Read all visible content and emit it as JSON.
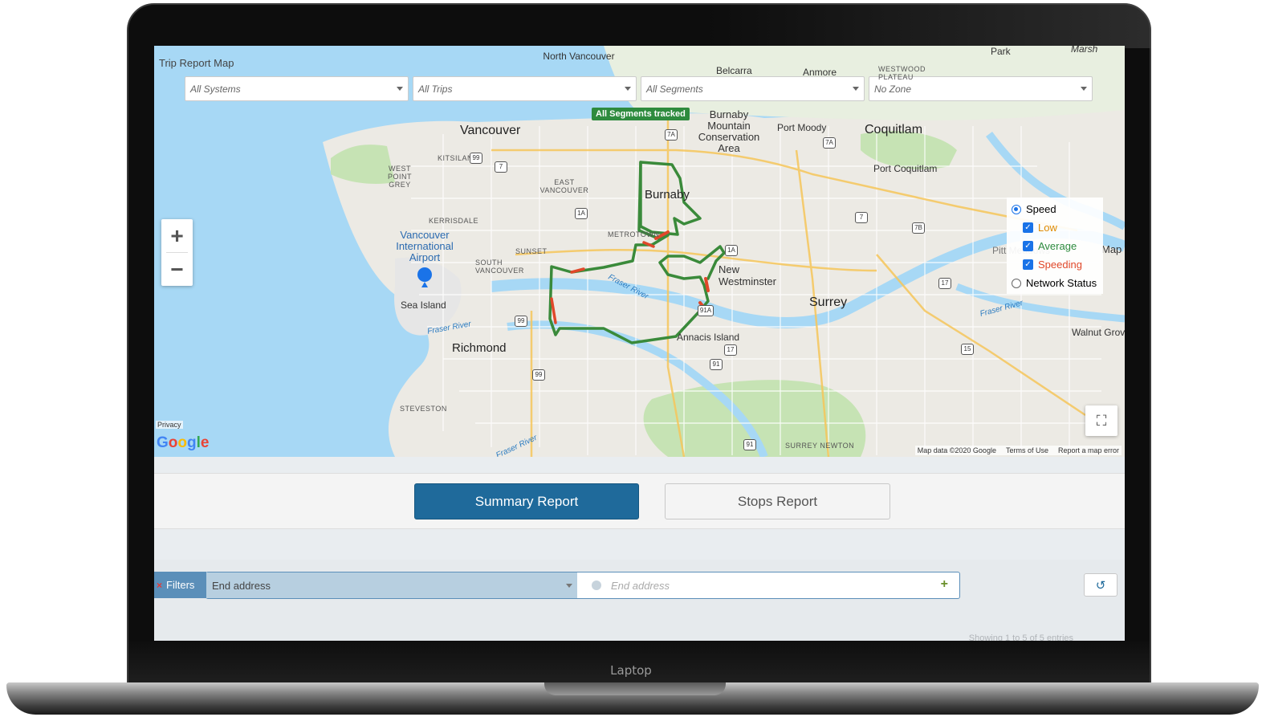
{
  "device": {
    "brand_label": "Laptop"
  },
  "map": {
    "title": "Trip Report Map",
    "filters": [
      {
        "placeholder": "All Systems"
      },
      {
        "placeholder": "All Trips"
      },
      {
        "placeholder": "All Segments"
      },
      {
        "placeholder": "No Zone"
      }
    ],
    "tracked_badge": "All Segments tracked",
    "zoom_in": "+",
    "zoom_out": "−",
    "legend": {
      "speed_label": "Speed",
      "low_label": "Low",
      "average_label": "Average",
      "speeding_label": "Speeding",
      "network_status_label": "Network Status",
      "colors": {
        "low": "#e08a00",
        "average": "#2e8b3e",
        "speeding": "#e0482a"
      }
    },
    "fullscreen_icon": "⛶",
    "privacy": "Privacy",
    "google_logo": "Google",
    "attribution": {
      "map_data": "Map data ©2020 Google",
      "terms": "Terms of Use",
      "report": "Report a map error"
    },
    "places": {
      "north_vancouver": "North Vancouver",
      "vancouver": "Vancouver",
      "burnaby": "Burnaby",
      "burnaby_mountain": "Burnaby Mountain Conservation Area",
      "port_moody": "Port Moody",
      "coquitlam": "Coquitlam",
      "port_coquitlam": "Port Coquitlam",
      "belcarra": "Belcarra",
      "anmore": "Anmore",
      "kitsilano": "KITSILANO",
      "west_point_grey": "WEST POINT GREY",
      "east_vancouver": "EAST VANCOUVER",
      "kerrisdale": "KERRISDALE",
      "sunset": "SUNSET",
      "south_vancouver": "SOUTH VANCOUVER",
      "airport": "Vancouver International Airport",
      "sea_island": "Sea Island",
      "richmond": "Richmond",
      "steveston": "STEVESTON",
      "new_westminster": "New Westminster",
      "annacis_island": "Annacis Island",
      "surrey": "Surrey",
      "surrey_newton": "SURREY NEWTON",
      "walnut_grove": "Walnut Grov",
      "pitt_meadows": "Pitt Meadows",
      "map_edge": "Map",
      "fraser_river": "Fraser River",
      "park": "Park",
      "marsh": "Marsh",
      "metrotown": "METROTOWN",
      "westwood_plateau": "WESTWOOD PLATEAU"
    },
    "highway_shields": [
      "99",
      "7",
      "1A",
      "7A",
      "1A",
      "99",
      "91A",
      "17",
      "91",
      "99",
      "91",
      "7",
      "7B",
      "17",
      "15",
      "7A"
    ]
  },
  "report_tabs": {
    "summary": "Summary Report",
    "stops": "Stops Report"
  },
  "filters_bar": {
    "tag_label": "Filters",
    "remove_icon": "×",
    "field_select_value": "End address",
    "value_placeholder": "End address",
    "add_icon": "+",
    "refresh_icon": "↺",
    "showing_text": "Showing 1 to 5 of 5 entries"
  }
}
